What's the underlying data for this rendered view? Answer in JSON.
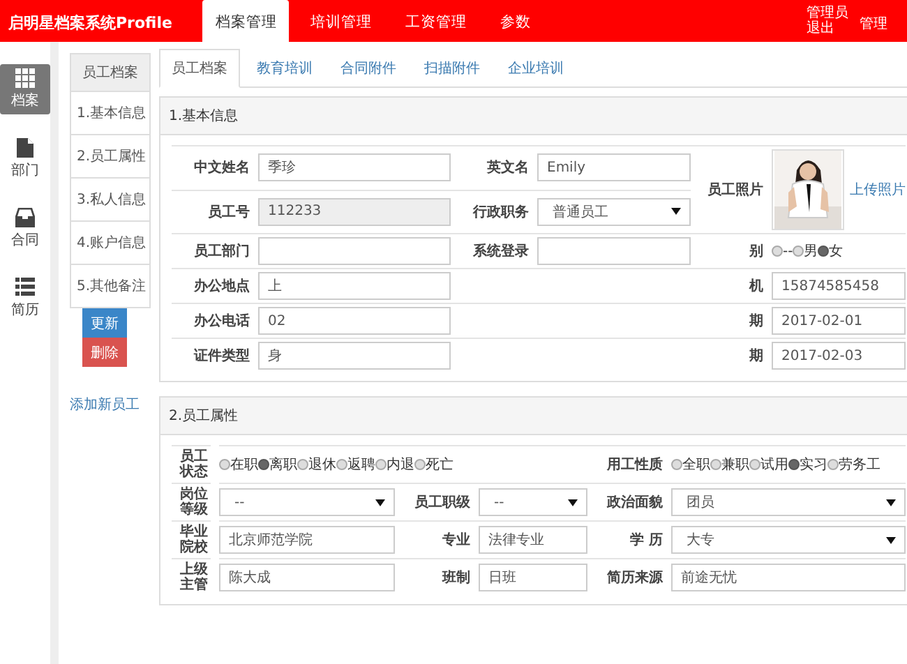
{
  "topbar": {
    "brand": "启明星档案系统Profile",
    "menu": [
      {
        "label": "档案管理",
        "selected": true
      },
      {
        "label": "培训管理",
        "selected": false
      },
      {
        "label": "工资管理",
        "selected": false
      },
      {
        "label": "参数",
        "selected": false
      }
    ],
    "user": "管理员退出",
    "admin": "管理"
  },
  "sidebar": {
    "items": [
      {
        "label": "档案",
        "selected": true
      },
      {
        "label": "部门",
        "selected": false
      },
      {
        "label": "合同",
        "selected": false
      },
      {
        "label": "简历",
        "selected": false
      }
    ]
  },
  "subnav": {
    "title": "员工档案",
    "items": [
      {
        "label": "1.基本信息",
        "selected": false
      },
      {
        "label": "2.员工属性",
        "selected": false
      },
      {
        "label": "3.私人信息",
        "selected": false
      },
      {
        "label": "4.账户信息",
        "selected": false
      },
      {
        "label": "5.其他备注",
        "selected": false
      }
    ],
    "buttons": [
      {
        "label": "更新",
        "kind": "primary"
      },
      {
        "label": "删除",
        "kind": "danger"
      }
    ],
    "link": "添加新员工"
  },
  "tabs": [
    {
      "label": "员工档案",
      "selected": true
    },
    {
      "label": "教育培训",
      "selected": false
    },
    {
      "label": "合同附件",
      "selected": false
    },
    {
      "label": "扫描附件",
      "selected": false
    },
    {
      "label": "企业培训",
      "selected": false
    }
  ],
  "sections": [
    {
      "title": "1.基本信息",
      "kind": "basic",
      "rows": [
        {
          "left": {
            "label": "中文姓名",
            "kind": "input",
            "value": "季珍"
          },
          "middle": {
            "label": "英文名",
            "kind": "input",
            "value": "Emily"
          },
          "right": {
            "label": "员工照片",
            "link": "上传照片"
          }
        },
        {
          "left": {
            "label": "员工号",
            "kind": "input",
            "value": "112233",
            "disabled": true
          },
          "middle": {
            "label": "行政职务",
            "kind": "select",
            "value": "普通员工"
          }
        },
        {
          "left": {
            "label": "员工部门",
            "kind": "input"
          },
          "middle": {
            "label": "系统登录",
            "kind": "input"
          },
          "right": {
            "label": "别",
            "kind": "radio",
            "options": [
              {
                "label": "--",
                "selected": false
              },
              {
                "label": "男",
                "selected": false
              },
              {
                "label": "女",
                "selected": true
              }
            ]
          }
        },
        {
          "left": {
            "label": "办公地点",
            "kind": "input",
            "value": "上"
          },
          "right": {
            "label": "机",
            "kind": "input",
            "value": "15874585458"
          }
        },
        {
          "left": {
            "label": "办公电话",
            "kind": "input",
            "value": "02"
          },
          "right": {
            "label": "期",
            "kind": "input",
            "value": "2017-02-01"
          }
        },
        {
          "left": {
            "label": "证件类型",
            "kind": "input",
            "value": "身"
          },
          "right": {
            "label": "期",
            "kind": "input",
            "value": "2017-02-03"
          }
        }
      ]
    },
    {
      "title": "2.员工属性",
      "kind": "attrs",
      "rows": [
        {
          "left": {
            "label": "员工状态",
            "kind": "radio",
            "options": [
              {
                "label": "在职",
                "selected": false
              },
              {
                "label": "离职",
                "selected": true
              },
              {
                "label": "退休",
                "selected": false
              },
              {
                "label": "返聘",
                "selected": false
              },
              {
                "label": "内退",
                "selected": false
              },
              {
                "label": "死亡",
                "selected": false
              }
            ]
          },
          "right": {
            "label": "用工性质",
            "kind": "radio",
            "options": [
              {
                "label": "全职",
                "selected": false
              },
              {
                "label": "兼职",
                "selected": false
              },
              {
                "label": "试用",
                "selected": false
              },
              {
                "label": "实习",
                "selected": true
              },
              {
                "label": "劳务工",
                "selected": false
              }
            ]
          }
        },
        {
          "left": {
            "label": "岗位等级",
            "kind": "select",
            "value": "--"
          },
          "middle": {
            "label": "员工职级",
            "kind": "select",
            "value": "--"
          },
          "right": {
            "label": "政治面貌",
            "kind": "select",
            "value": "团员"
          }
        },
        {
          "left": {
            "label": "毕业院校",
            "kind": "input",
            "value": "北京师范学院"
          },
          "middle": {
            "label": "专业",
            "kind": "input",
            "value": "法律专业"
          },
          "right": {
            "label": "学 历",
            "kind": "select",
            "value": "大专"
          }
        },
        {
          "left": {
            "label": "上级主管",
            "kind": "input",
            "value": "陈大成"
          },
          "middle": {
            "label": "班制",
            "kind": "input",
            "value": "日班"
          },
          "right": {
            "label": "简历来源",
            "kind": "input",
            "value": "前途无忧"
          }
        }
      ]
    }
  ]
}
